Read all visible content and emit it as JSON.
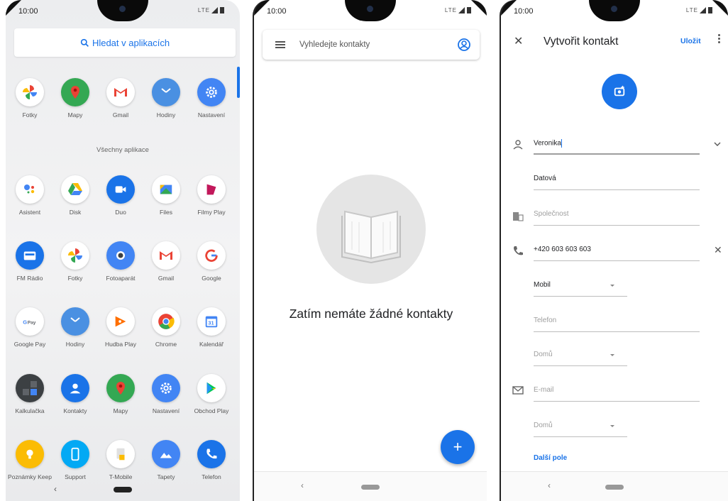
{
  "panel1": {
    "time": "10:00",
    "status": "LTE",
    "search_label": "Hledat v aplikacích",
    "section_title": "Všechny aplikace",
    "favorites": [
      {
        "name": "Fotky",
        "icon": "pinwheel-icon",
        "color": "#ffffff"
      },
      {
        "name": "Mapy",
        "icon": "maps-icon",
        "color": "#34a853"
      },
      {
        "name": "Gmail",
        "icon": "gmail-icon",
        "color": "#ffffff"
      },
      {
        "name": "Hodiny",
        "icon": "clock-icon",
        "color": "#4a90e2"
      },
      {
        "name": "Nastavení",
        "icon": "gear-icon",
        "color": "#4285f4"
      }
    ],
    "apps": [
      {
        "name": "Asistent",
        "icon": "assistant-icon",
        "color": "#ffffff"
      },
      {
        "name": "Disk",
        "icon": "drive-icon",
        "color": "#ffffff"
      },
      {
        "name": "Duo",
        "icon": "duo-icon",
        "color": "#1a73e8"
      },
      {
        "name": "Files",
        "icon": "files-icon",
        "color": "#ffffff"
      },
      {
        "name": "Filmy Play",
        "icon": "play-movies-icon",
        "color": "#ffffff"
      },
      {
        "name": "FM Rádio",
        "icon": "radio-icon",
        "color": "#1a73e8"
      },
      {
        "name": "Fotky",
        "icon": "pinwheel-icon",
        "color": "#ffffff"
      },
      {
        "name": "Fotoaparát",
        "icon": "camera-icon",
        "color": "#4285f4"
      },
      {
        "name": "Gmail",
        "icon": "gmail-icon",
        "color": "#ffffff"
      },
      {
        "name": "Google",
        "icon": "google-icon",
        "color": "#ffffff"
      },
      {
        "name": "Google Pay",
        "icon": "gpay-icon",
        "color": "#ffffff"
      },
      {
        "name": "Hodiny",
        "icon": "clock-icon",
        "color": "#4a90e2"
      },
      {
        "name": "Hudba Play",
        "icon": "play-music-icon",
        "color": "#ffffff"
      },
      {
        "name": "Chrome",
        "icon": "chrome-icon",
        "color": "#ffffff"
      },
      {
        "name": "Kalendář",
        "icon": "calendar-icon",
        "color": "#ffffff"
      },
      {
        "name": "Kalkulačka",
        "icon": "calculator-icon",
        "color": "#3c4043"
      },
      {
        "name": "Kontakty",
        "icon": "contacts-icon",
        "color": "#1a73e8"
      },
      {
        "name": "Mapy",
        "icon": "maps-icon",
        "color": "#34a853"
      },
      {
        "name": "Nastavení",
        "icon": "gear-icon",
        "color": "#4285f4"
      },
      {
        "name": "Obchod Play",
        "icon": "play-store-icon",
        "color": "#ffffff"
      },
      {
        "name": "Poznámky Keep",
        "icon": "keep-icon",
        "color": "#fbbc04"
      },
      {
        "name": "Support",
        "icon": "support-icon",
        "color": "#03a9f4"
      },
      {
        "name": "T-Mobile",
        "icon": "tmobile-icon",
        "color": "#ffffff"
      },
      {
        "name": "Tapety",
        "icon": "wallpaper-icon",
        "color": "#4285f4"
      },
      {
        "name": "Telefon",
        "icon": "phone-icon",
        "color": "#1a73e8"
      }
    ]
  },
  "panel2": {
    "time": "10:00",
    "search_placeholder": "Vyhledejte kontakty",
    "empty_message": "Zatím nemáte žádné kontakty",
    "fab_label": "+"
  },
  "panel3": {
    "time": "10:00",
    "title": "Vytvořit kontakt",
    "save_label": "Uložit",
    "first_name": "Veronika",
    "last_name": "Datová",
    "company_placeholder": "Společnost",
    "phone": "+420 603 603 603",
    "phone_type": "Mobil",
    "phone2_placeholder": "Telefon",
    "phone2_type": "Domů",
    "email_placeholder": "E-mail",
    "email_type": "Domů",
    "more_fields": "Další pole"
  }
}
